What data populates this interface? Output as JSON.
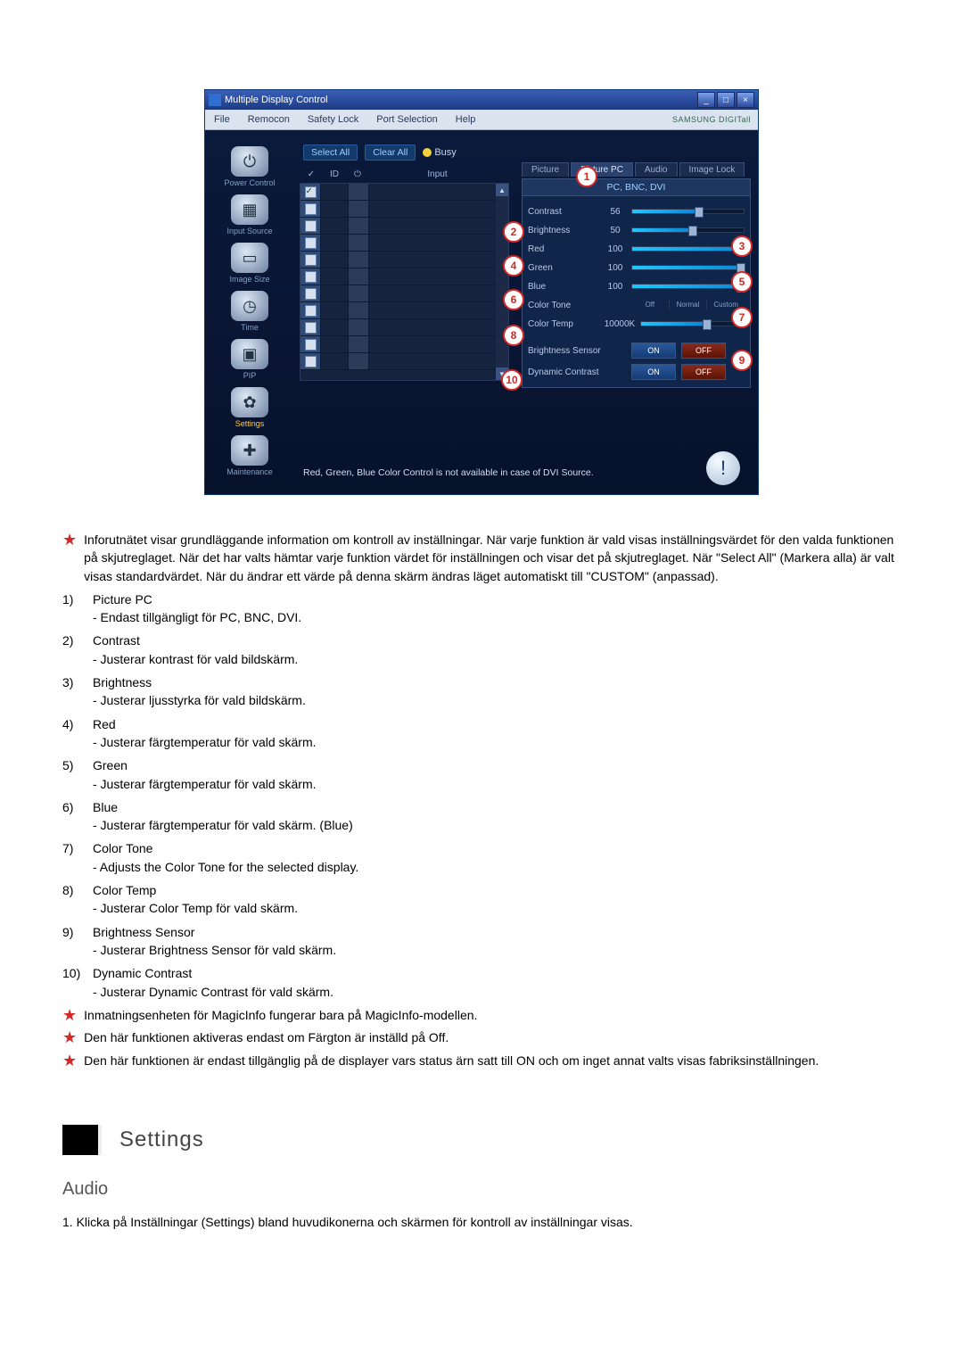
{
  "app": {
    "title": "Multiple Display Control",
    "win_buttons": {
      "min": "_",
      "max": "□",
      "close": "×"
    },
    "menu": [
      "File",
      "Remocon",
      "Safety Lock",
      "Port Selection",
      "Help"
    ],
    "brand": "SAMSUNG DIGITall"
  },
  "sidebar": [
    {
      "label": "Power Control",
      "glyph": "⏻"
    },
    {
      "label": "Input Source",
      "glyph": "▦"
    },
    {
      "label": "Image Size",
      "glyph": "▭"
    },
    {
      "label": "Time",
      "glyph": "◷"
    },
    {
      "label": "PIP",
      "glyph": "▣"
    },
    {
      "label": "Settings",
      "glyph": "✿",
      "active": true
    },
    {
      "label": "Maintenance",
      "glyph": "✚"
    }
  ],
  "select": {
    "select_all": "Select All",
    "clear_all": "Clear All",
    "busy_label": "Busy"
  },
  "grid": {
    "headers": {
      "chk": "✓",
      "id": "ID",
      "pwr": "⏻",
      "input": "Input"
    },
    "rows": 11
  },
  "tabs": [
    "Picture",
    "Picture PC",
    "Audio",
    "Image Lock"
  ],
  "active_tab_index": 1,
  "subheader": "PC, BNC, DVI",
  "settings": {
    "contrast": {
      "label": "Contrast",
      "value": "56",
      "pct": 56
    },
    "brightness": {
      "label": "Brightness",
      "value": "50",
      "pct": 50
    },
    "red": {
      "label": "Red",
      "value": "100",
      "pct": 100
    },
    "green": {
      "label": "Green",
      "value": "100",
      "pct": 100
    },
    "blue": {
      "label": "Blue",
      "value": "100",
      "pct": 100
    },
    "color_tone": {
      "label": "Color Tone",
      "options": [
        "Off",
        "Normal",
        "Custom"
      ],
      "sel": 1
    },
    "color_temp": {
      "label": "Color Temp",
      "value": "10000K",
      "pct": 60
    },
    "bright_sensor": {
      "label": "Brightness Sensor",
      "on": "ON",
      "off": "OFF"
    },
    "dyn_contrast": {
      "label": "Dynamic Contrast",
      "on": "ON",
      "off": "OFF"
    }
  },
  "footer_note": "Red, Green, Blue Color Control is not available in case of DVI Source.",
  "callouts": [
    "1",
    "2",
    "3",
    "4",
    "5",
    "6",
    "7",
    "8",
    "9",
    "10"
  ],
  "chart_data": {
    "type": "table",
    "settings": [
      {
        "name": "Contrast",
        "value": 56,
        "unit": ""
      },
      {
        "name": "Brightness",
        "value": 50,
        "unit": ""
      },
      {
        "name": "Red",
        "value": 100,
        "unit": ""
      },
      {
        "name": "Green",
        "value": 100,
        "unit": ""
      },
      {
        "name": "Blue",
        "value": 100,
        "unit": ""
      },
      {
        "name": "Color Temp",
        "value": 10000,
        "unit": "K"
      }
    ],
    "toggles": [
      {
        "name": "Brightness Sensor",
        "options": [
          "ON",
          "OFF"
        ]
      },
      {
        "name": "Dynamic Contrast",
        "options": [
          "ON",
          "OFF"
        ]
      }
    ],
    "color_tone_options": [
      "Off",
      "Normal",
      "Custom"
    ]
  },
  "doc": {
    "intro_star": "Inforutnätet visar grundläggande information om kontroll av inställningar. När varje funktion är vald visas inställningsvärdet för den valda funktionen på skjutreglaget. När det har valts hämtar varje funktion värdet för inställningen och visar det på skjutreglaget. När \"Select All\" (Markera alla) är valt visas standardvärdet. När du ändrar ett värde på denna skärm ändras läget automatiskt till \"CUSTOM\" (anpassad).",
    "items": [
      {
        "n": "1)",
        "t": "Picture PC",
        "d": "- Endast tillgängligt för PC, BNC, DVI."
      },
      {
        "n": "2)",
        "t": "Contrast",
        "d": "- Justerar kontrast för vald bildskärm."
      },
      {
        "n": "3)",
        "t": "Brightness",
        "d": "- Justerar ljusstyrka för vald bildskärm."
      },
      {
        "n": "4)",
        "t": "Red",
        "d": "- Justerar färgtemperatur för vald skärm."
      },
      {
        "n": "5)",
        "t": "Green",
        "d": "- Justerar färgtemperatur för vald skärm."
      },
      {
        "n": "6)",
        "t": "Blue",
        "d": "- Justerar färgtemperatur för vald skärm. (Blue)"
      },
      {
        "n": "7)",
        "t": "Color Tone",
        "d": "- Adjusts the Color Tone for the selected display."
      },
      {
        "n": "8)",
        "t": "Color Temp",
        "d": "- Justerar Color Temp för vald skärm."
      },
      {
        "n": "9)",
        "t": "Brightness Sensor",
        "d": "- Justerar Brightness Sensor för vald skärm."
      },
      {
        "n": "10)",
        "t": "Dynamic Contrast",
        "d": "- Justerar Dynamic Contrast för vald skärm."
      }
    ],
    "stars": [
      "Inmatningsenheten för MagicInfo fungerar bara på MagicInfo-modellen.",
      "Den här funktionen aktiveras endast om Färgton är inställd på Off.",
      "Den här funktionen är endast tillgänglig på de displayer vars status ärn satt till ON och om inget annat valts visas fabriksinställningen."
    ],
    "section_title": "Settings",
    "subtitle": "Audio",
    "step1": "1. Klicka på Inställningar (Settings) bland huvudikonerna och skärmen för kontroll av inställningar visas."
  }
}
